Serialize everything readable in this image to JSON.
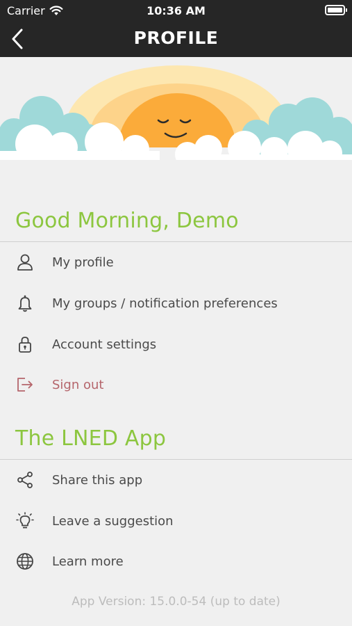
{
  "status_bar": {
    "carrier": "Carrier",
    "time": "10:36 AM"
  },
  "nav": {
    "title": "PROFILE"
  },
  "greeting": "Good Morning, Demo",
  "account_menu": [
    {
      "label": "My profile",
      "icon": "person-icon"
    },
    {
      "label": "My groups / notification preferences",
      "icon": "bell-icon"
    },
    {
      "label": "Account settings",
      "icon": "lock-icon"
    },
    {
      "label": "Sign out",
      "icon": "sign-out-icon"
    }
  ],
  "app_section_title": "The LNED App",
  "app_menu": [
    {
      "label": "Share this app",
      "icon": "share-icon"
    },
    {
      "label": "Leave a suggestion",
      "icon": "lightbulb-icon"
    },
    {
      "label": "Learn more",
      "icon": "globe-icon"
    }
  ],
  "version": "App Version: 15.0.0-54 (up to date)",
  "colors": {
    "accent": "#8cc63f",
    "signout": "#b5656b",
    "header": "#262626",
    "background": "#f0f0f0"
  }
}
